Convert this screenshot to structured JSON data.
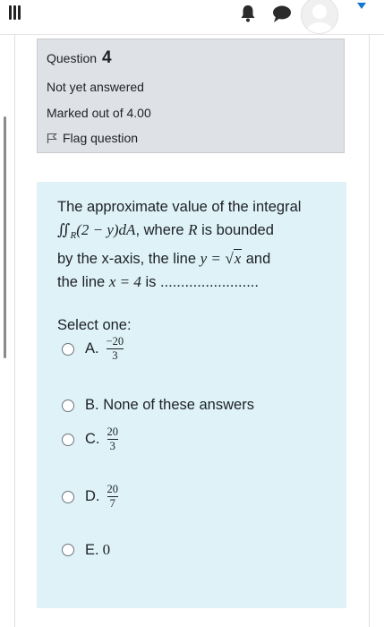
{
  "nav": {
    "menu_icon": "hamburger-menu-icon",
    "notification_icon": "bell-icon",
    "messages_icon": "chat-bubble-icon",
    "user_icon": "avatar",
    "dropdown_icon": "caret-down-icon",
    "accent_color": "#1177d1"
  },
  "info": {
    "question_label": "Question",
    "question_number": "4",
    "status": "Not yet answered",
    "marks": "Marked out of 4.00",
    "flag_label": "Flag question"
  },
  "question": {
    "text_intro": "The approximate value of the integral",
    "integral_symbol": "∬",
    "integral_region": "R",
    "integrand": "(2 − y)dA",
    "text_where": ", where",
    "region_var": "R",
    "text_bounded": "is bounded",
    "text_by": "by the x-axis, the line",
    "curve_lhs": "y =",
    "curve_rad": "x",
    "text_and": "and",
    "text_line": "the line",
    "line_eq": "x = 4",
    "text_is": "is ........................",
    "select_prompt": "Select one:",
    "options": [
      {
        "letter": "A.",
        "numerator": "−20",
        "denominator": "3"
      },
      {
        "letter": "B.",
        "text": "None of these answers"
      },
      {
        "letter": "C.",
        "numerator": "20",
        "denominator": "3"
      },
      {
        "letter": "D.",
        "numerator": "20",
        "denominator": "7"
      },
      {
        "letter": "E.",
        "value": "0"
      }
    ]
  },
  "colors": {
    "info_bg": "#dee2e6",
    "question_bg": "#def2f8"
  }
}
